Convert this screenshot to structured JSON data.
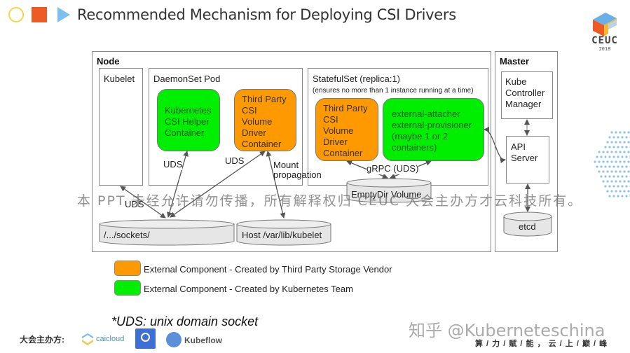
{
  "header": {
    "title": "Recommended Mechanism for Deploying CSI Drivers",
    "icons": [
      "circle-icon",
      "square-icon",
      "play-triangle-icon"
    ]
  },
  "logo": {
    "name": "CEUC",
    "year": "2018"
  },
  "diagram": {
    "node": {
      "title": "Node",
      "kubelet": "Kubelet",
      "daemonset": {
        "title": "DaemonSet Pod",
        "helper": [
          "Kubernetes",
          "CSI Helper",
          "Container"
        ],
        "driver": [
          "Third Party",
          "CSI",
          "Volume",
          "Driver",
          "Container"
        ]
      },
      "statefulset": {
        "title": "StatefulSet (replica:1)",
        "subtitle": "(ensures no more than 1 instance running at a time)",
        "driver": [
          "Third Party",
          "CSI",
          "Volume",
          "Driver",
          "Container"
        ],
        "sidecars": [
          "external-attacher",
          "external-provisioner",
          "(maybe 1 or 2",
          "containers)"
        ],
        "volume": "EmptyDir Volume",
        "grpc_label": "gRPC (UDS)"
      },
      "edge_labels": {
        "uds_helper": "UDS",
        "uds_driver": "UDS",
        "uds_kubelet": "UDS",
        "mount": "Mount",
        "propagation": "propagation"
      },
      "sockets": "/.../sockets/",
      "host_kubelet": "Host /var/lib/kubelet"
    },
    "master": {
      "title": "Master",
      "controller": [
        "Kube",
        "Controller",
        "Manager"
      ],
      "api": [
        "API",
        "Server"
      ],
      "etcd": "etcd"
    }
  },
  "legend": [
    {
      "color": "#ff9900",
      "label": "External Component - Created by Third Party Storage Vendor"
    },
    {
      "color": "#00ee00",
      "label": "External Component - Created by Kubernetes Team"
    }
  ],
  "footnote": "*UDS: unix domain socket",
  "watermark": "本 PPT 未经允许请勿传播，所有解释权归 CEUC 大会主办方才云科技所有。",
  "footer": {
    "organizer_label": "大会主办方:",
    "sponsors": [
      "caicloud",
      "Kubeflow"
    ],
    "zhihu": "知乎 @Kuberneteschina",
    "slogan": "算 / 力 / 赋 / 能 ， 云 / 上 / 巅 / 峰"
  }
}
